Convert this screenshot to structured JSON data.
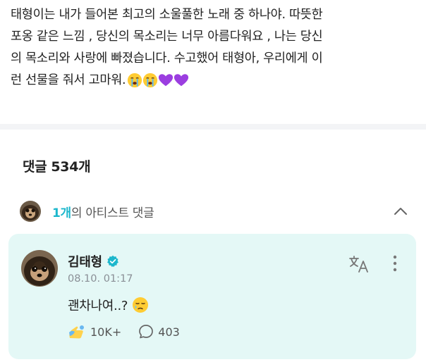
{
  "post": {
    "lines": [
      "태형이는 내가 들어본 최고의 소울풀한 노래 중 하나야. 따뜻한",
      "포옹 같은 느낌 , 당신의 목소리는 너무 아름다워요 , 나는 당신",
      "의 목소리와 사랑에 빠졌습니다. 수고했어 태형아, 우리에게 이",
      "런 선물을 줘서 고마워."
    ],
    "emojis": [
      "crying-face-emoji",
      "crying-face-emoji",
      "purple-heart-emoji",
      "purple-heart-emoji"
    ]
  },
  "comments": {
    "label": "댓글",
    "count": "534개"
  },
  "artist_bar": {
    "count": "1개",
    "label": "의 아티스트 댓글",
    "icon": "chevron-up-icon"
  },
  "artist_comment": {
    "name": "김태형",
    "timestamp": "08.10. 01:17",
    "text": "괜차나여..?",
    "emoji": "sleepy-face-emoji",
    "likes": "10K+",
    "replies": "403",
    "colors": {
      "card_bg": "#e4f8f6",
      "accent": "#1cb7cc"
    }
  }
}
